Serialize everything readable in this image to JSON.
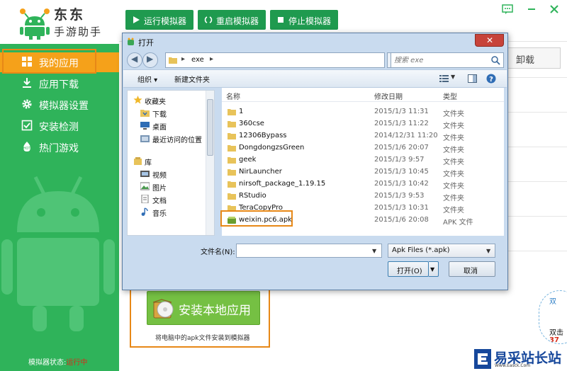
{
  "app": {
    "logo_line1": "东东",
    "logo_line2": "手游助手",
    "brand_color": "#2fb35a",
    "active_color": "#f5a11a"
  },
  "toolbar": {
    "run_label": "运行模拟器",
    "restart_label": "重启模拟器",
    "stop_label": "停止模拟器"
  },
  "sidebar": {
    "items": [
      {
        "label": "我的应用",
        "icon": "grid-icon"
      },
      {
        "label": "应用下载",
        "icon": "download-icon"
      },
      {
        "label": "模拟器设置",
        "icon": "gear-icon"
      },
      {
        "label": "安装检测",
        "icon": "check-icon"
      },
      {
        "label": "热门游戏",
        "icon": "hot-icon"
      }
    ],
    "status_label": "模拟器状态:",
    "status_value": "运行中"
  },
  "content": {
    "uninstall_label": "卸载",
    "install_label": "安装本地应用",
    "install_hint": "将电脑中的apk文件安装到模拟器",
    "badge_line1": "双",
    "badge_line2": "双击",
    "badge_line3": "37"
  },
  "watermark": {
    "line1": "易采站长站",
    "line2": "Www.Easck.Com"
  },
  "dialog": {
    "title": "打开",
    "path_crumb": "exe",
    "search_placeholder": "搜索 exe",
    "organize_label": "组织 ▾",
    "new_folder_label": "新建文件夹",
    "tree": {
      "favorites": "收藏夹",
      "download": "下载",
      "desktop": "桌面",
      "recent": "最近访问的位置",
      "library": "库",
      "videos": "视频",
      "pictures": "图片",
      "documents": "文档",
      "music": "音乐"
    },
    "columns": {
      "name": "名称",
      "modified": "修改日期",
      "type": "类型"
    },
    "files": [
      {
        "name": "1",
        "date": "2015/1/3 11:31",
        "type": "文件夹"
      },
      {
        "name": "360cse",
        "date": "2015/1/3 11:22",
        "type": "文件夹"
      },
      {
        "name": "12306Bypass",
        "date": "2014/12/31 11:20",
        "type": "文件夹"
      },
      {
        "name": "DongdongzsGreen",
        "date": "2015/1/6 20:07",
        "type": "文件夹"
      },
      {
        "name": "geek",
        "date": "2015/1/3 9:57",
        "type": "文件夹"
      },
      {
        "name": "NirLauncher",
        "date": "2015/1/3 10:45",
        "type": "文件夹"
      },
      {
        "name": "nirsoft_package_1.19.15",
        "date": "2015/1/3 10:42",
        "type": "文件夹"
      },
      {
        "name": "RStudio",
        "date": "2015/1/3 9:53",
        "type": "文件夹"
      },
      {
        "name": "TeraCopyPro",
        "date": "2015/1/3 10:31",
        "type": "文件夹"
      },
      {
        "name": "weixin.pc6.apk",
        "date": "2015/1/6 20:08",
        "type": "APK 文件"
      }
    ],
    "filename_label": "文件名(N):",
    "filename_value": "",
    "filetype_value": "Apk Files (*.apk)",
    "open_label": "打开(O)",
    "cancel_label": "取消"
  }
}
